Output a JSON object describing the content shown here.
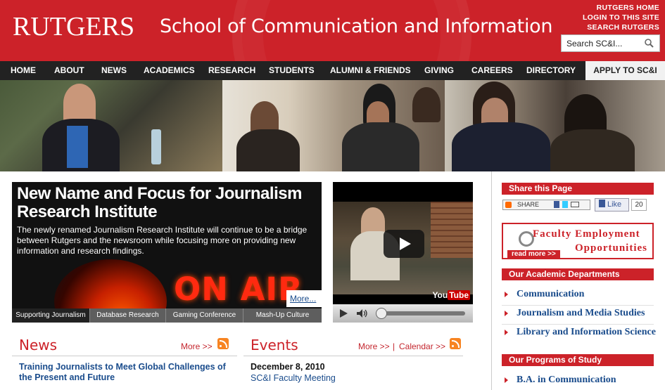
{
  "header": {
    "logo": "RUTGERS",
    "school_name": "School of Communication and Information",
    "top_links": [
      "RUTGERS HOME",
      "LOGIN TO THIS SITE",
      "SEARCH RUTGERS"
    ],
    "search_placeholder": "Search SC&I..."
  },
  "nav": {
    "items": [
      "HOME",
      "ABOUT",
      "NEWS",
      "ACADEMICS",
      "RESEARCH",
      "STUDENTS",
      "ALUMNI & FRIENDS",
      "GIVING",
      "CAREERS",
      "DIRECTORY"
    ],
    "apply": "APPLY TO SC&I"
  },
  "feature": {
    "headline": "New Name and Focus for Journalism Research Institute",
    "body": "The newly renamed Journalism Research Institute will continue to be a bridge between Rutgers and the newsroom while focusing more on providing new information and research findings.",
    "image_text": "ON AIR",
    "more": "More...",
    "tabs": [
      "Supporting Journalism",
      "Database Research",
      "Gaming Conference",
      "Mash-Up Culture"
    ],
    "active_tab": 0
  },
  "video": {
    "brand_you": "You",
    "brand_tube": "Tube"
  },
  "news": {
    "title": "News",
    "more": "More >>",
    "items": [
      "Training Journalists to Meet Global Challenges of the Present and Future"
    ]
  },
  "events": {
    "title": "Events",
    "more": "More >>",
    "separator": "|",
    "calendar": "Calendar >>",
    "date": "December 8, 2010",
    "event": "SC&I Faculty Meeting"
  },
  "sidebar": {
    "share_title": "Share this Page",
    "share_label": "SHARE",
    "like_label": "Like",
    "like_count": "20",
    "faculty_line1": "Faculty Employment",
    "faculty_line2": "Opportunities",
    "read_more": "read more >>",
    "departments_title": "Our Academic Departments",
    "departments": [
      "Communication",
      "Journalism and Media Studies",
      "Library and Information Science"
    ],
    "programs_title": "Our Programs of Study",
    "programs": [
      "B.A. in Communication"
    ]
  },
  "colors": {
    "brand_red": "#cc2229",
    "nav_black": "#222222",
    "link_blue": "#1a4c8c"
  },
  "icons": [
    "search-icon",
    "play-icon",
    "volume-icon",
    "rss-icon",
    "share-icon",
    "facebook-like-icon",
    "magnifier-icon",
    "arrow-right-icon"
  ]
}
